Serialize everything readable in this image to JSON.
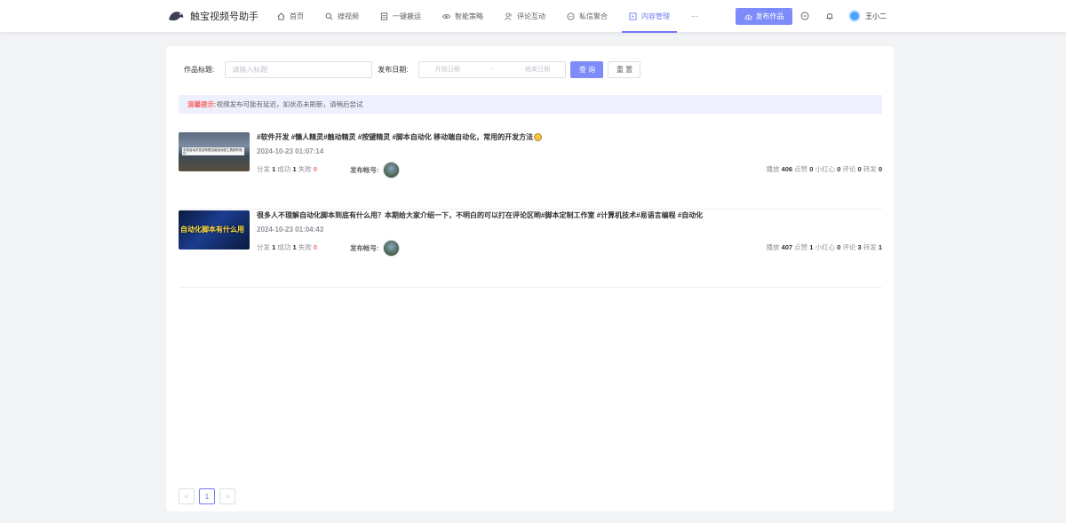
{
  "app": {
    "title": "触宝视频号助手"
  },
  "nav": [
    {
      "label": "首页",
      "icon": "home-icon"
    },
    {
      "label": "搜视频",
      "icon": "search-icon"
    },
    {
      "label": "一键搬运",
      "icon": "document-icon"
    },
    {
      "label": "智能策略",
      "icon": "eye-icon"
    },
    {
      "label": "评论互动",
      "icon": "users-icon"
    },
    {
      "label": "私信聚合",
      "icon": "chat-icon"
    },
    {
      "label": "内容管理",
      "icon": "content-icon",
      "active": true
    },
    {
      "label": "···",
      "icon": "more-icon"
    }
  ],
  "header": {
    "publish_label": "发布作品",
    "user_name": "王小二"
  },
  "filter": {
    "title_label": "作品标题:",
    "title_placeholder": "请输入标题",
    "date_label": "发布日期:",
    "start_placeholder": "开始日期",
    "range_separator": "~",
    "end_placeholder": "结束日期",
    "query_label": "查 询",
    "reset_label": "重 置"
  },
  "tip": {
    "label": "温馨提示:",
    "text": "视频发布可能有延迟，如状态未刷新，请稍后尝试"
  },
  "items": [
    {
      "title": "#软件开发 #懒人精灵#触动精灵 #按键精灵 #脚本自动化 移动端自动化，常用的开发方法",
      "thumb_caption": "手机自动开发没有是否被自动化工具制作而57",
      "date": "2024-10-23 01:07:14",
      "dist_label": "分发",
      "dist": "1",
      "success_label": "成功",
      "success": "1",
      "fail_label": "失败",
      "fail": "0",
      "account_label": "发布帐号:",
      "plays_label": "播放",
      "plays": "406",
      "likes_label": "点赞",
      "likes": "0",
      "hearts_label": "小红心",
      "hearts": "0",
      "comments_label": "评论",
      "comments": "0",
      "shares_label": "转发",
      "shares": "0"
    },
    {
      "title": "很多人不理解自动化脚本到底有什么用？本期给大家介绍一下，不明白的可以打在评论区哟#脚本定制工作室 #计算机技术#易语言编程 #自动化",
      "thumb_caption": "自动化脚本有什么用",
      "date": "2024-10-23 01:04:43",
      "dist_label": "分发",
      "dist": "1",
      "success_label": "成功",
      "success": "1",
      "fail_label": "失败",
      "fail": "0",
      "account_label": "发布帐号:",
      "plays_label": "播放",
      "plays": "407",
      "likes_label": "点赞",
      "likes": "1",
      "hearts_label": "小红心",
      "hearts": "0",
      "comments_label": "评论",
      "comments": "3",
      "shares_label": "转发",
      "shares": "1"
    }
  ],
  "pagination": {
    "prev": "<",
    "current": "1",
    "next": ">"
  },
  "colors": {
    "accent": "#7d8cf8",
    "danger": "#f56c6c",
    "tip_bg": "#eef0fd"
  }
}
